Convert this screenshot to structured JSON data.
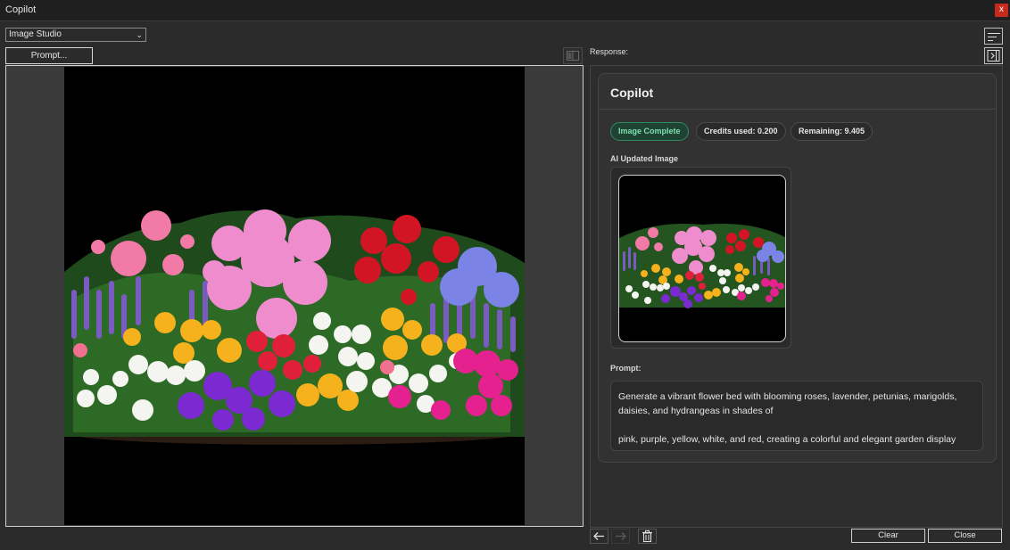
{
  "window": {
    "title": "Copilot",
    "close_glyph": "x"
  },
  "toolbar": {
    "mode_select_value": "Image Studio",
    "prompt_button_label": "Prompt...",
    "response_label": "Response:"
  },
  "card": {
    "title": "Copilot",
    "status_badge": "Image Complete",
    "credits_used": "Credits used: 0.200",
    "remaining": "Remaining: 9.405",
    "image_section_label": "AI Updated Image",
    "prompt_section_label": "Prompt:",
    "prompt_line1": "Generate a vibrant flower bed with blooming roses, lavender, petunias, marigolds, daisies, and hydrangeas in shades of",
    "prompt_line2": "pink, purple, yellow, white, and red, creating a colorful and elegant garden display"
  },
  "footer": {
    "clear_label": "Clear",
    "close_label": "Close"
  },
  "icons": {
    "compare": "split-view-icon",
    "sort": "sort-lines-icon",
    "collapse": "collapse-panel-icon",
    "back": "arrow-left-icon",
    "forward": "arrow-right-icon",
    "delete": "trash-icon"
  },
  "colors": {
    "accent_green": "#2f8a5f",
    "close_red": "#c42b1c",
    "background": "#2b2b2b"
  }
}
